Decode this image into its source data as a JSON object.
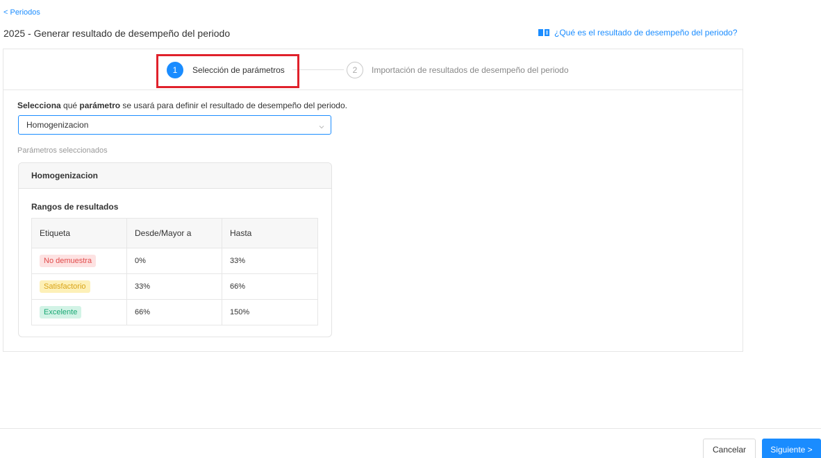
{
  "breadcrumb": {
    "back_label": "< Periodos"
  },
  "header": {
    "title": "2025 - Generar resultado de desempeño del periodo",
    "help_link": "¿Qué es el resultado de desempeño del periodo?"
  },
  "steps": [
    {
      "number": "1",
      "label": "Selección de parámetros",
      "state": "active"
    },
    {
      "number": "2",
      "label": "Importación de resultados de desempeño del periodo",
      "state": "pending"
    }
  ],
  "form": {
    "instruction_bold_1": "Selecciona",
    "instruction_text_1": " qué ",
    "instruction_bold_2": "parámetro",
    "instruction_text_2": " se usará para definir el resultado de desempeño del periodo.",
    "select_value": "Homogenizacion",
    "params_label": "Parámetros seleccionados"
  },
  "param_card": {
    "name": "Homogenizacion",
    "ranges_title": "Rangos de resultados",
    "columns": [
      "Etiqueta",
      "Desde/Mayor a",
      "Hasta"
    ],
    "rows": [
      {
        "label": "No demuestra",
        "from": "0%",
        "to": "33%",
        "color": "#fde2e2"
      },
      {
        "label": "Satisfactorio",
        "from": "33%",
        "to": "66%",
        "color": "#fdf0b8"
      },
      {
        "label": "Excelente",
        "from": "66%",
        "to": "150%",
        "color": "#d2f3e6"
      }
    ]
  },
  "footer": {
    "cancel_label": "Cancelar",
    "next_label": "Siguiente >"
  },
  "colors": {
    "accent": "#1a8cff",
    "highlight": "#e0212b"
  }
}
